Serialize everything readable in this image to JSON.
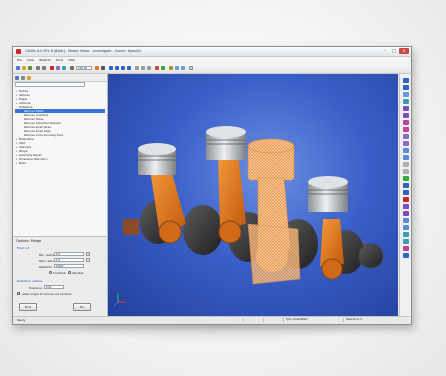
{
  "window": {
    "title": "CADfix 8.0 SP2.8 [64bit] - Model: Motor - Investigate - Owner: Kpaul(S)",
    "minimize_glyph": "–",
    "maximize_glyph": "□",
    "close_glyph": "✕"
  },
  "menu": [
    "File",
    "View",
    "Wizards",
    "Tools",
    "Help"
  ],
  "toolbar": {
    "zoom_value": "100.00"
  },
  "left_panel": {
    "search_placeholder": "",
    "tree": [
      {
        "twisty": "+",
        "indent": 0,
        "label": "Bodies"
      },
      {
        "twisty": "+",
        "indent": 0,
        "label": "Vertices"
      },
      {
        "twisty": "+",
        "indent": 0,
        "label": "Edges"
      },
      {
        "twisty": "+",
        "indent": 0,
        "label": "Surfaces"
      },
      {
        "twisty": "–",
        "indent": 0,
        "label": "Defeature"
      },
      {
        "twisty": "",
        "indent": 1,
        "label": "Remove Fillets",
        "selected": true
      },
      {
        "twisty": "",
        "indent": 1,
        "label": "Remove chamfers"
      },
      {
        "twisty": "",
        "indent": 1,
        "label": "Remove Holes"
      },
      {
        "twisty": "",
        "indent": 1,
        "label": "Remove imprinted features"
      },
      {
        "twisty": "",
        "indent": 1,
        "label": "Remove small faces"
      },
      {
        "twisty": "",
        "indent": 1,
        "label": "Remove small edge"
      },
      {
        "twisty": "",
        "indent": 1,
        "label": "Remove circle boundary face"
      },
      {
        "twisty": "+",
        "indent": 0,
        "label": "Midsurface"
      },
      {
        "twisty": "+",
        "indent": 0,
        "label": "Split"
      },
      {
        "twisty": "+",
        "indent": 0,
        "label": "Intersect"
      },
      {
        "twisty": "+",
        "indent": 0,
        "label": "Merge"
      },
      {
        "twisty": "+",
        "indent": 0,
        "label": "Geometry Repair"
      },
      {
        "twisty": "+",
        "indent": 0,
        "label": "Dimension Reduction"
      },
      {
        "twisty": "+",
        "indent": 0,
        "label": "Build"
      }
    ]
  },
  "options": {
    "title": "Options: Merge",
    "subtitle": "Fillet cut",
    "min_radius_label": "Min. radius",
    "min_radius_value": "0.5",
    "max_radius_label": "Max. radius",
    "max_radius_value": "1.0",
    "radial_tol_label": "Radial tol",
    "radial_tol_value": "0.001",
    "radio1_label": "Constant",
    "radio2_label": "Variable",
    "section2": "Detection options",
    "tolerance_label": "Tolerance",
    "tolerance_value": "0.01",
    "checkbox_label": "Allow edges to remove old sections",
    "find_button": "Find",
    "fix_button": "Fix"
  },
  "status": {
    "text": "Ready",
    "cells": [
      "",
      "",
      "Type: DefaultPart",
      "Selections: 0"
    ]
  },
  "colors": {
    "viewport_bg": "#3a5fc8",
    "accent_orange": "#e8761e",
    "selection_blue": "#3875d7",
    "piston_silver": "#c9ccd1",
    "mesh_orange": "#f2a65a"
  },
  "icons": {
    "app": "cadfix-logo-icon",
    "axes": "coordinate-axes-icon"
  }
}
